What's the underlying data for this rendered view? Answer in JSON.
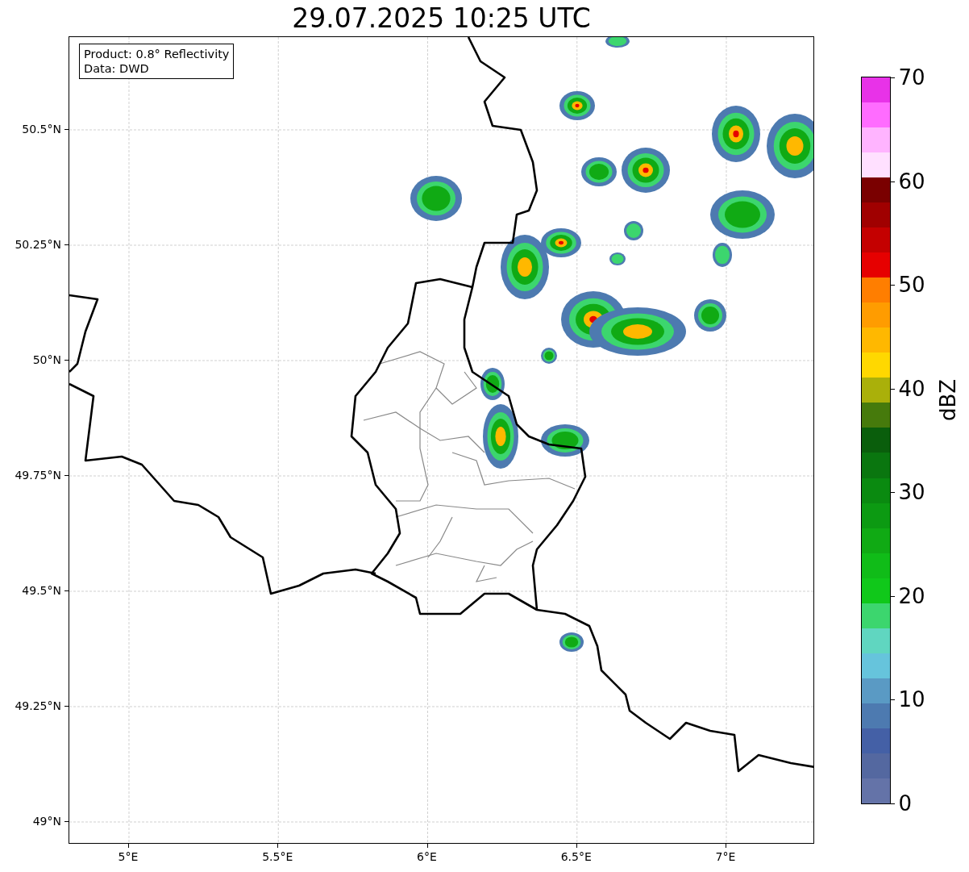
{
  "title": "29.07.2025 10:25 UTC",
  "info_box": [
    "Product: 0.8° Reflectivity",
    "Data: DWD"
  ],
  "y_ticks": [
    "50.5°N",
    "50.25°N",
    "50°N",
    "49.75°N",
    "49.5°N",
    "49.25°N",
    "49°N"
  ],
  "x_ticks": [
    "5°E",
    "5.5°E",
    "6°E",
    "6.5°E",
    "7°E"
  ],
  "colorbar": {
    "label": "dBZ",
    "ticks": [
      "70",
      "60",
      "50",
      "40",
      "30",
      "20",
      "10",
      "0"
    ],
    "bands": [
      {
        "color": "#e832e8"
      },
      {
        "color": "#ff6cff"
      },
      {
        "color": "#ffb4ff"
      },
      {
        "color": "#ffe0ff"
      },
      {
        "color": "#7a0000"
      },
      {
        "color": "#a00000"
      },
      {
        "color": "#c40000"
      },
      {
        "color": "#e60000"
      },
      {
        "color": "#ff7e00"
      },
      {
        "color": "#ff9c00"
      },
      {
        "color": "#ffb800"
      },
      {
        "color": "#ffd800"
      },
      {
        "color": "#aab00a"
      },
      {
        "color": "#467a0c"
      },
      {
        "color": "#0a5e0c"
      },
      {
        "color": "#0a760f"
      },
      {
        "color": "#0a8a10"
      },
      {
        "color": "#0c9a12"
      },
      {
        "color": "#10aa14"
      },
      {
        "color": "#10bc18"
      },
      {
        "color": "#10c81a"
      },
      {
        "color": "#3cd66e"
      },
      {
        "color": "#60d6c0"
      },
      {
        "color": "#66c4dc"
      },
      {
        "color": "#5a9ac4"
      },
      {
        "color": "#4d7ab0"
      },
      {
        "color": "#4460a6"
      },
      {
        "color": "#5468a0"
      },
      {
        "color": "#6473a8"
      }
    ]
  }
}
